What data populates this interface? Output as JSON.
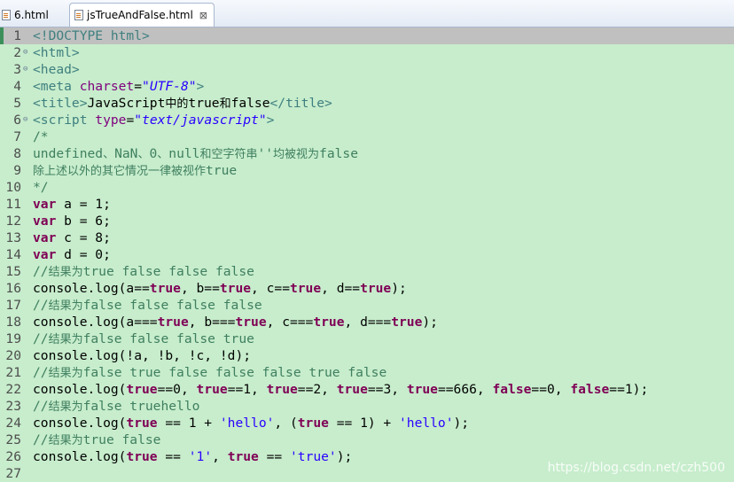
{
  "tabs": [
    {
      "label": "6.html",
      "active": false
    },
    {
      "label": "jsTrueAndFalse.html",
      "active": true,
      "close": "⊠"
    }
  ],
  "lines": [
    {
      "n": "1",
      "tokens": [
        [
          "tag",
          "<!DOCTYPE html>"
        ]
      ]
    },
    {
      "n": "2",
      "tokens": [
        [
          "tag",
          "<html>"
        ]
      ]
    },
    {
      "n": "3",
      "tokens": [
        [
          "tag",
          "<head>"
        ]
      ]
    },
    {
      "n": "4",
      "tokens": [
        [
          "tag",
          "<meta "
        ],
        [
          "attr",
          "charset"
        ],
        [
          "plain",
          "="
        ],
        [
          "str",
          "\"UTF-8\""
        ],
        [
          "tag",
          ">"
        ]
      ]
    },
    {
      "n": "5",
      "tokens": [
        [
          "tag",
          "<title>"
        ],
        [
          "plain",
          "JavaScript"
        ],
        [
          "plaincjk",
          "中的"
        ],
        [
          "plain",
          "true"
        ],
        [
          "plaincjk",
          "和"
        ],
        [
          "plain",
          "false"
        ],
        [
          "tag",
          "</title>"
        ]
      ]
    },
    {
      "n": "6",
      "tokens": [
        [
          "tag",
          "<script "
        ],
        [
          "attr",
          "type"
        ],
        [
          "plain",
          "="
        ],
        [
          "str",
          "\"text/javascript\""
        ],
        [
          "tag",
          ">"
        ]
      ]
    },
    {
      "n": "7",
      "tokens": [
        [
          "com",
          "/*"
        ]
      ]
    },
    {
      "n": "8",
      "tokens": [
        [
          "com",
          "undefined"
        ],
        [
          "comcjk",
          "、"
        ],
        [
          "com",
          "NaN"
        ],
        [
          "comcjk",
          "、"
        ],
        [
          "com",
          "0"
        ],
        [
          "comcjk",
          "、"
        ],
        [
          "com",
          "null"
        ],
        [
          "comcjk",
          "和空字符串"
        ],
        [
          "com",
          "''"
        ],
        [
          "comcjk",
          "均被视为"
        ],
        [
          "com",
          "false"
        ]
      ]
    },
    {
      "n": "9",
      "tokens": [
        [
          "comcjk",
          "除上述以外的其它情况一律被视作"
        ],
        [
          "com",
          "true"
        ]
      ]
    },
    {
      "n": "10",
      "tokens": [
        [
          "com",
          "*/"
        ]
      ]
    },
    {
      "n": "11",
      "tokens": [
        [
          "kw",
          "var"
        ],
        [
          "plain",
          " a = 1;"
        ]
      ]
    },
    {
      "n": "12",
      "tokens": [
        [
          "kw",
          "var"
        ],
        [
          "plain",
          " b = 6;"
        ]
      ]
    },
    {
      "n": "13",
      "tokens": [
        [
          "kw",
          "var"
        ],
        [
          "plain",
          " c = 8;"
        ]
      ]
    },
    {
      "n": "14",
      "tokens": [
        [
          "kw",
          "var"
        ],
        [
          "plain",
          " d = 0;"
        ]
      ]
    },
    {
      "n": "15",
      "tokens": [
        [
          "com",
          "//"
        ],
        [
          "comcjk",
          "结果为"
        ],
        [
          "com",
          "true false false false"
        ]
      ]
    },
    {
      "n": "16",
      "tokens": [
        [
          "plain",
          "console.log(a=="
        ],
        [
          "kw",
          "true"
        ],
        [
          "plain",
          ", b=="
        ],
        [
          "kw",
          "true"
        ],
        [
          "plain",
          ", c=="
        ],
        [
          "kw",
          "true"
        ],
        [
          "plain",
          ", d=="
        ],
        [
          "kw",
          "true"
        ],
        [
          "plain",
          ");"
        ]
      ]
    },
    {
      "n": "17",
      "tokens": [
        [
          "com",
          "//"
        ],
        [
          "comcjk",
          "结果为"
        ],
        [
          "com",
          "false false false false"
        ]
      ]
    },
    {
      "n": "18",
      "tokens": [
        [
          "plain",
          "console.log(a==="
        ],
        [
          "kw",
          "true"
        ],
        [
          "plain",
          ", b==="
        ],
        [
          "kw",
          "true"
        ],
        [
          "plain",
          ", c==="
        ],
        [
          "kw",
          "true"
        ],
        [
          "plain",
          ", d==="
        ],
        [
          "kw",
          "true"
        ],
        [
          "plain",
          ");"
        ]
      ]
    },
    {
      "n": "19",
      "tokens": [
        [
          "com",
          "//"
        ],
        [
          "comcjk",
          "结果为"
        ],
        [
          "com",
          "false false false true"
        ]
      ]
    },
    {
      "n": "20",
      "tokens": [
        [
          "plain",
          "console.log(!a, !b, !c, !d);"
        ]
      ]
    },
    {
      "n": "21",
      "tokens": [
        [
          "com",
          "//"
        ],
        [
          "comcjk",
          "结果为"
        ],
        [
          "com",
          "false true false false false true false"
        ]
      ]
    },
    {
      "n": "22",
      "tokens": [
        [
          "plain",
          "console.log("
        ],
        [
          "kw",
          "true"
        ],
        [
          "plain",
          "==0, "
        ],
        [
          "kw",
          "true"
        ],
        [
          "plain",
          "==1, "
        ],
        [
          "kw",
          "true"
        ],
        [
          "plain",
          "==2, "
        ],
        [
          "kw",
          "true"
        ],
        [
          "plain",
          "==3, "
        ],
        [
          "kw",
          "true"
        ],
        [
          "plain",
          "==666, "
        ],
        [
          "kw",
          "false"
        ],
        [
          "plain",
          "==0, "
        ],
        [
          "kw",
          "false"
        ],
        [
          "plain",
          "==1);"
        ]
      ]
    },
    {
      "n": "23",
      "tokens": [
        [
          "com",
          "//"
        ],
        [
          "comcjk",
          "结果为"
        ],
        [
          "com",
          "false truehello"
        ]
      ]
    },
    {
      "n": "24",
      "tokens": [
        [
          "plain",
          "console.log("
        ],
        [
          "kw",
          "true"
        ],
        [
          "plain",
          " == 1 + "
        ],
        [
          "sstr",
          "'hello'"
        ],
        [
          "plain",
          ", ("
        ],
        [
          "kw",
          "true"
        ],
        [
          "plain",
          " == 1) + "
        ],
        [
          "sstr",
          "'hello'"
        ],
        [
          "plain",
          ");"
        ]
      ]
    },
    {
      "n": "25",
      "tokens": [
        [
          "com",
          "//"
        ],
        [
          "comcjk",
          "结果为"
        ],
        [
          "com",
          "true false"
        ]
      ]
    },
    {
      "n": "26",
      "tokens": [
        [
          "plain",
          "console.log("
        ],
        [
          "kw",
          "true"
        ],
        [
          "plain",
          " == "
        ],
        [
          "sstr",
          "'1'"
        ],
        [
          "plain",
          ", "
        ],
        [
          "kw",
          "true"
        ],
        [
          "plain",
          " == "
        ],
        [
          "sstr",
          "'true'"
        ],
        [
          "plain",
          ");"
        ]
      ]
    },
    {
      "n": "27",
      "tokens": []
    }
  ],
  "fold_marker": "⊖",
  "watermark": "https://blog.csdn.net/czh500",
  "colors": {
    "background": "#c7edcc",
    "current_line": "#c0c0c0",
    "tag": "#3f7f7f",
    "attribute": "#7f007f",
    "string": "#2a00ff",
    "comment": "#3f7f5f",
    "keyword": "#7f0055"
  }
}
